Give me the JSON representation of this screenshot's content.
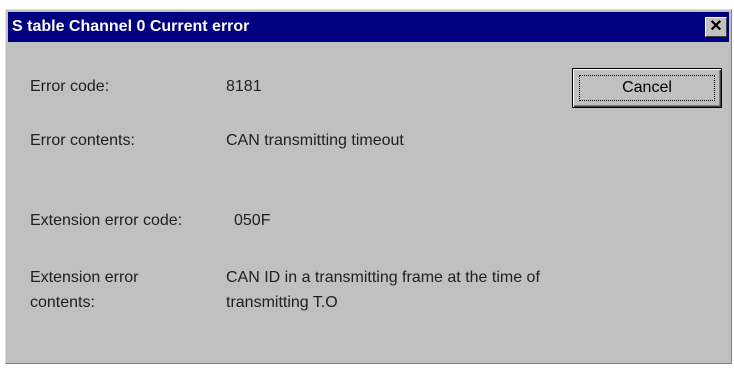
{
  "window": {
    "title": "S table Channel 0 Current error",
    "close_glyph": "✕"
  },
  "fields": {
    "error_code_label": "Error code:",
    "error_code_value": "8181",
    "error_contents_label": "Error contents:",
    "error_contents_value": "CAN transmitting timeout",
    "ext_error_code_label": "Extension error code:",
    "ext_error_code_value": "050F",
    "ext_error_contents_label_line1": "Extension error",
    "ext_error_contents_label_line2": "contents:",
    "ext_error_contents_value_line1": "CAN ID in a transmitting frame at the time of",
    "ext_error_contents_value_line2": "transmitting T.O"
  },
  "buttons": {
    "cancel_label": "Cancel"
  },
  "colors": {
    "titlebar": "#000080",
    "dialog_face": "#c0c0c0"
  }
}
